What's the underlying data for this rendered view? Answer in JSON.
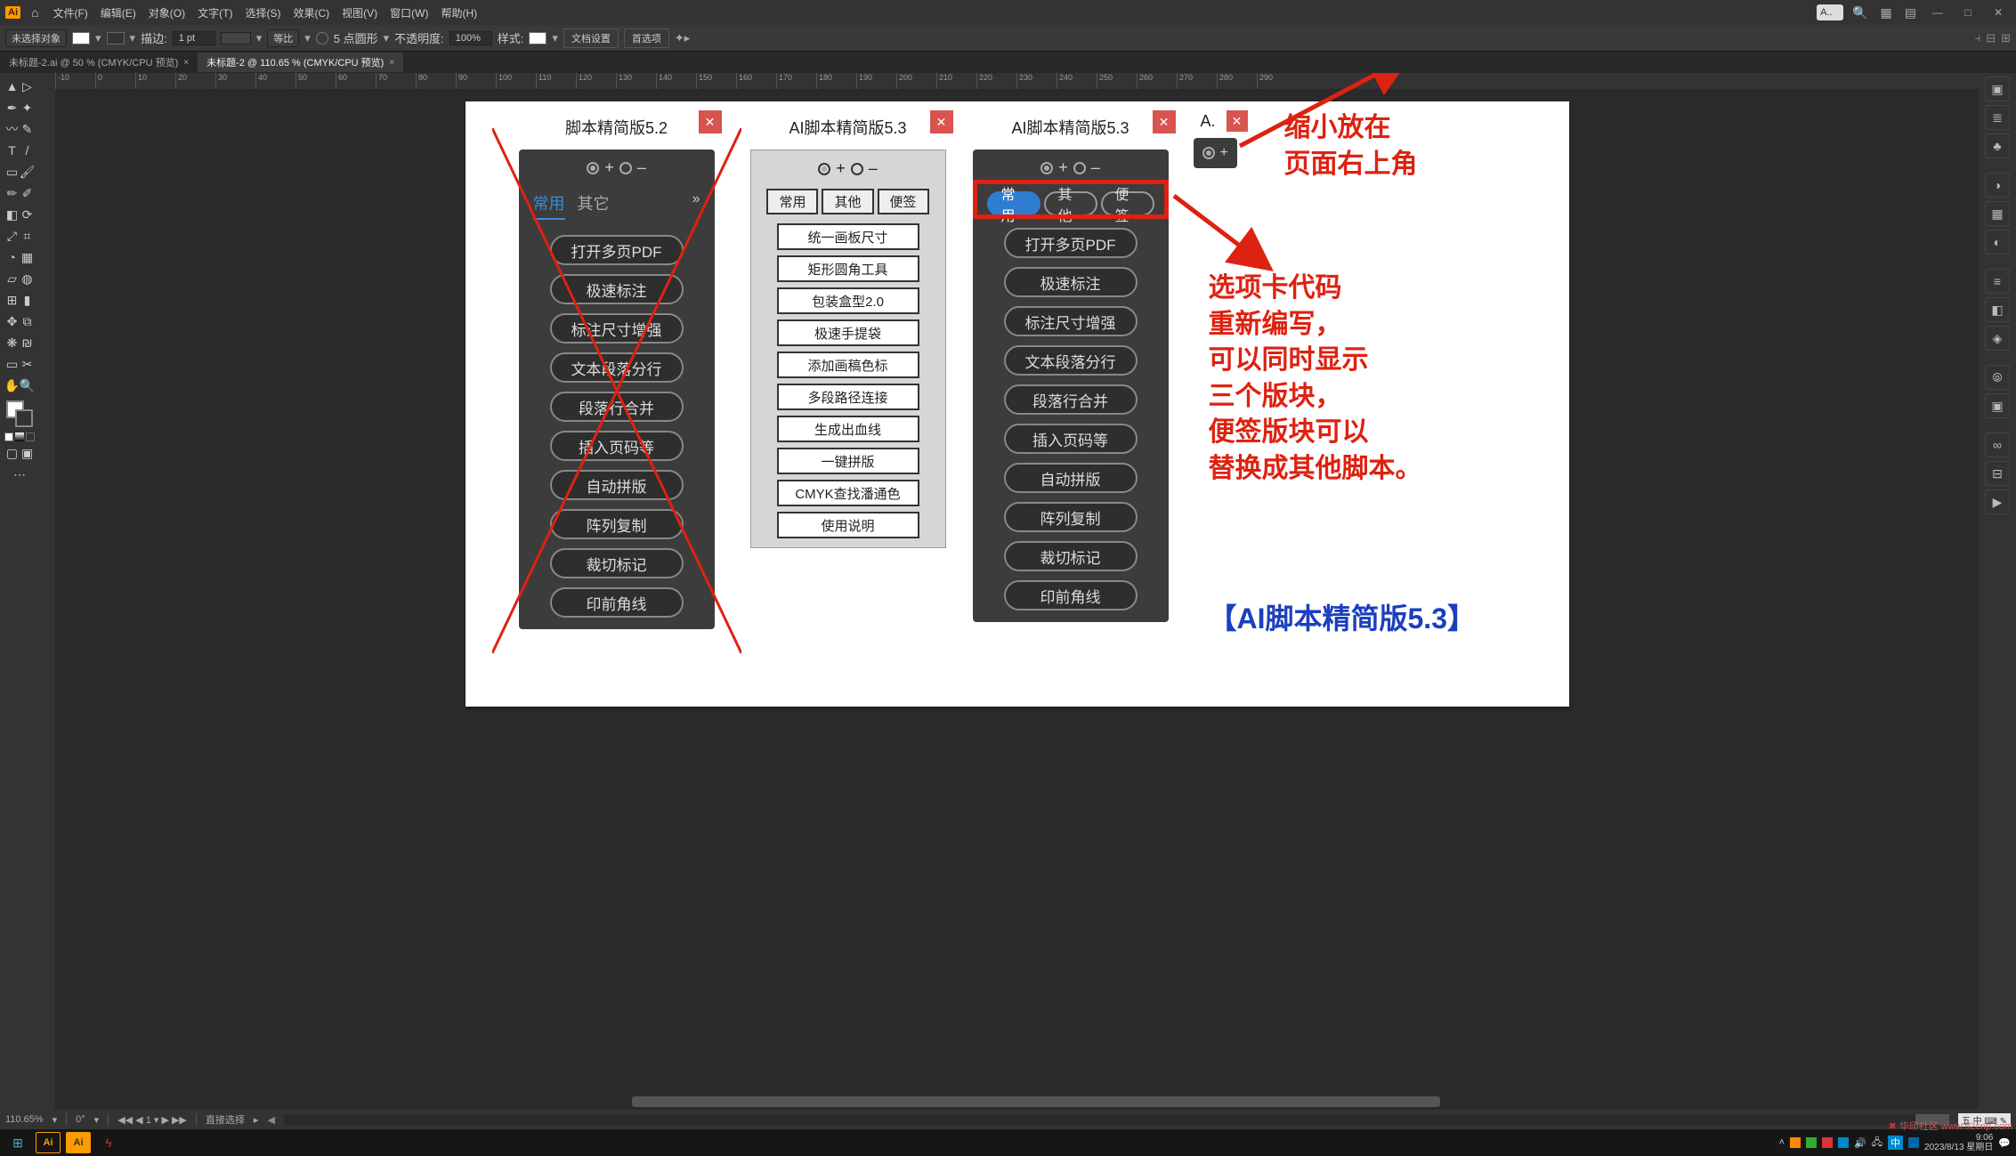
{
  "app_menus": [
    "文件(F)",
    "编辑(E)",
    "对象(O)",
    "文字(T)",
    "选择(S)",
    "效果(C)",
    "视图(V)",
    "窗口(W)",
    "帮助(H)"
  ],
  "search_placeholder": "A..",
  "ctrl": {
    "no_selection": "未选择对象",
    "stroke_label": "描边:",
    "stroke_value": "1 pt",
    "uniform": "等比",
    "round_label": "5 点圆形",
    "opacity_label": "不透明度:",
    "opacity_value": "100%",
    "style_label": "样式:",
    "btn_doc_setup": "文档设置",
    "btn_prefs": "首选项"
  },
  "tabs": [
    {
      "label": "未标题-2.ai @ 50 % (CMYK/CPU 预览)",
      "active": false
    },
    {
      "label": "未标题-2 @ 110.65 % (CMYK/CPU 预览)",
      "active": true
    }
  ],
  "ruler_values": [
    "-10",
    "0",
    "10",
    "20",
    "30",
    "40",
    "50",
    "60",
    "70",
    "80",
    "90",
    "100",
    "110",
    "120",
    "130",
    "140",
    "150",
    "160",
    "170",
    "180",
    "190",
    "200",
    "210",
    "220",
    "230",
    "240",
    "250",
    "260",
    "270",
    "280",
    "290"
  ],
  "panel1": {
    "title": "脚本精简版5.2",
    "tabs": [
      "常用",
      "其它"
    ],
    "buttons": [
      "打开多页PDF",
      "极速标注",
      "标注尺寸增强",
      "文本段落分行",
      "段落行合并",
      "插入页码等",
      "自动拼版",
      "阵列复制",
      "裁切标记",
      "印前角线"
    ]
  },
  "panel2": {
    "title": "AI脚本精简版5.3",
    "tabs": [
      "常用",
      "其他",
      "便签"
    ],
    "buttons": [
      "统一画板尺寸",
      "矩形圆角工具",
      "包装盒型2.0",
      "极速手提袋",
      "添加画稿色标",
      "多段路径连接",
      "生成出血线",
      "一键拼版",
      "CMYK查找潘通色",
      "使用说明"
    ]
  },
  "panel3": {
    "title": "AI脚本精简版5.3",
    "tabs": [
      "常用",
      "其他",
      "便签"
    ],
    "buttons": [
      "打开多页PDF",
      "极速标注",
      "标注尺寸增强",
      "文本段落分行",
      "段落行合并",
      "插入页码等",
      "自动拼版",
      "阵列复制",
      "裁切标记",
      "印前角线"
    ]
  },
  "mini_panel": {
    "title": "A."
  },
  "callouts": {
    "c1": "缩小放在\n页面右上角",
    "c2": "选项卡代码\n重新编写，\n可以同时显示\n三个版块，\n便签版块可以\n替换成其他脚本。",
    "c3": "【AI脚本精简版5.3】"
  },
  "status": {
    "zoom": "110.65%",
    "rotate": "0°",
    "artboard": "1",
    "tool": "直接选择"
  },
  "taskbar": {
    "time": "9:06",
    "date": "2023/8/13 星期日",
    "ime": "中",
    "corner_badge": "五 中 ⌨ ✎"
  },
  "watermark": "华印社区 www.52cnp.com",
  "icons": {
    "close": "✕",
    "home": "⌂",
    "search": "🔍",
    "layout": "▦",
    "min": "—",
    "max": "□",
    "chev": "»"
  }
}
